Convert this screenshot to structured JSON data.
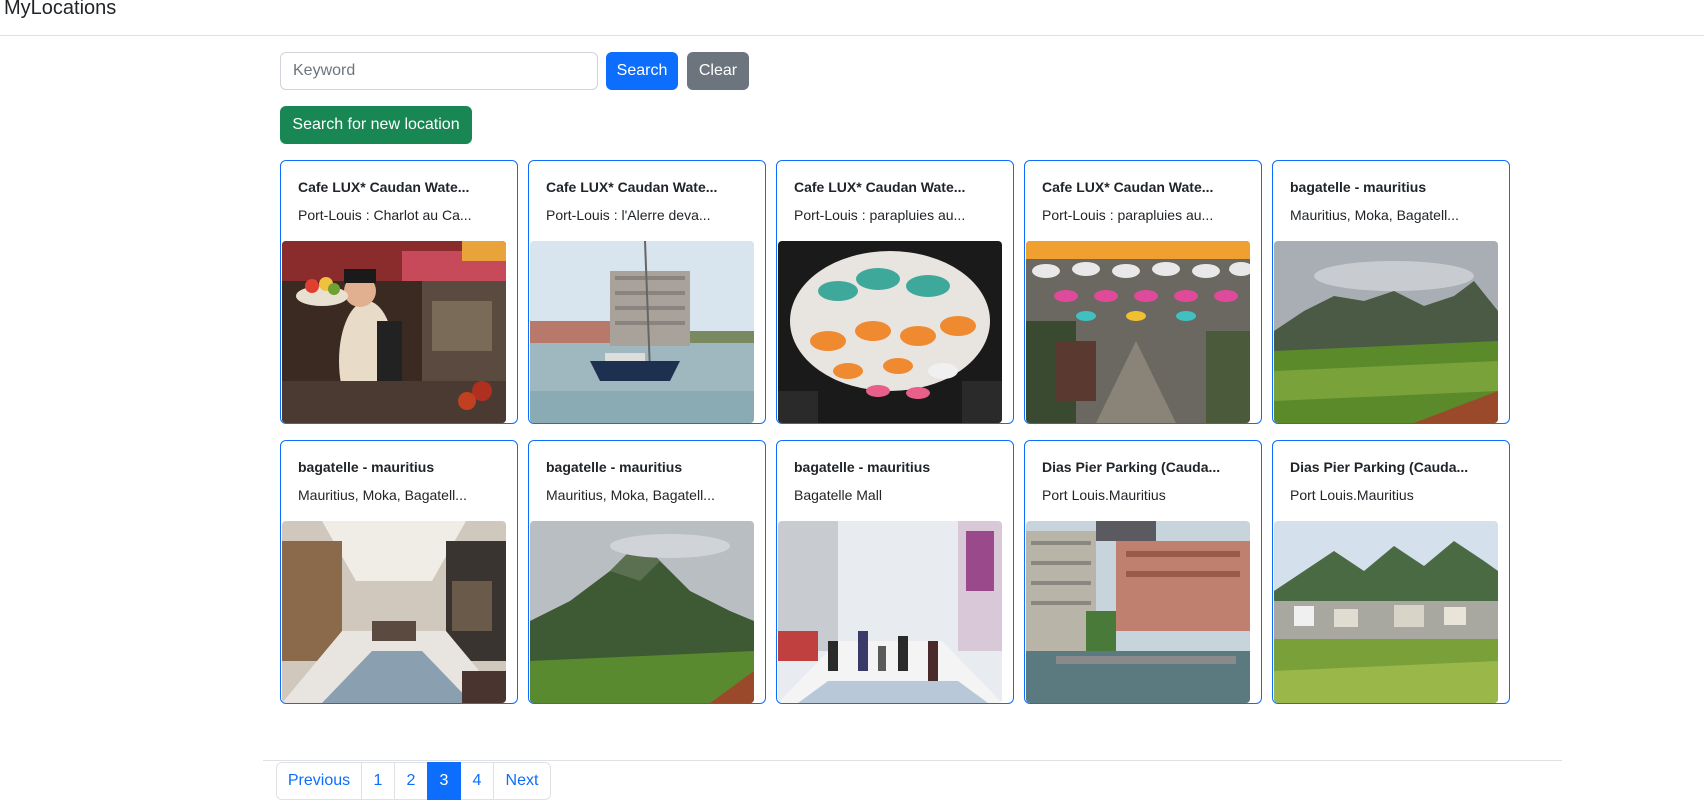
{
  "app": {
    "brand": "MyLocations"
  },
  "search": {
    "placeholder": "Keyword",
    "value": "",
    "search_label": "Search",
    "clear_label": "Clear"
  },
  "actions": {
    "new_location_label": "Search for new location"
  },
  "cards": [
    {
      "title": "Cafe LUX* Caudan Wate...",
      "subtitle": "Port-Louis : Charlot au Ca..."
    },
    {
      "title": "Cafe LUX* Caudan Wate...",
      "subtitle": "Port-Louis : l'Alerre deva..."
    },
    {
      "title": "Cafe LUX* Caudan Wate...",
      "subtitle": "Port-Louis : parapluies au..."
    },
    {
      "title": "Cafe LUX* Caudan Wate...",
      "subtitle": "Port-Louis : parapluies au..."
    },
    {
      "title": "bagatelle - mauritius",
      "subtitle": "Mauritius, Moka, Bagatell..."
    },
    {
      "title": "bagatelle - mauritius",
      "subtitle": "Mauritius, Moka, Bagatell..."
    },
    {
      "title": "bagatelle - mauritius",
      "subtitle": "Mauritius, Moka, Bagatell..."
    },
    {
      "title": "bagatelle - mauritius",
      "subtitle": "Bagatelle Mall"
    },
    {
      "title": "Dias Pier Parking (Cauda...",
      "subtitle": "Port Louis.Mauritius"
    },
    {
      "title": "Dias Pier Parking (Cauda...",
      "subtitle": "Port Louis.Mauritius"
    }
  ],
  "pagination": {
    "previous_label": "Previous",
    "pages": [
      "1",
      "2",
      "3",
      "4"
    ],
    "active_page": "3",
    "next_label": "Next"
  },
  "colors": {
    "primary": "#0d6efd",
    "secondary": "#6c757d",
    "success": "#198754"
  }
}
